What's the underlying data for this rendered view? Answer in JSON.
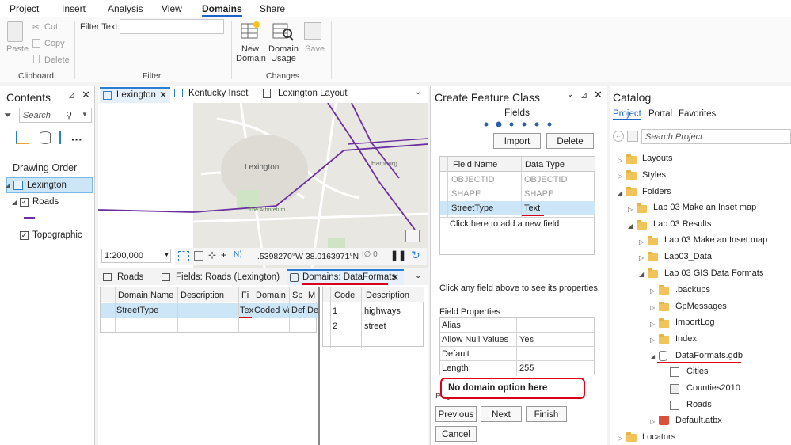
{
  "menu": [
    "Project",
    "Insert",
    "Analysis",
    "View",
    "Domains",
    "Share"
  ],
  "ribbon": {
    "paste": "Paste",
    "cut": "Cut",
    "copy": "Copy",
    "delete": "Delete",
    "clipboard_group": "Clipboard",
    "filter_text_label": "Filter Text:",
    "filter_text_value": "",
    "filter_group": "Filter",
    "new_domain": [
      "New",
      "Domain"
    ],
    "domain_usage": [
      "Domain",
      "Usage"
    ],
    "save": "Save",
    "changes_group": "Changes"
  },
  "contents": {
    "title": "Contents",
    "search_placeholder": "Search",
    "drawing_order": "Drawing Order",
    "layers": [
      "Lexington",
      "Roads",
      "Topographic"
    ]
  },
  "map_tabs": [
    "Lexington",
    "Kentucky Inset",
    "Lexington Layout"
  ],
  "map": {
    "scale": "1:200,000",
    "coords": ".5398270°W 38.0163971°N",
    "labels": [
      "Lexington",
      "Hamburg",
      "The Arboretum"
    ]
  },
  "bottom_tabs": [
    "Roads",
    "Fields:  Roads (Lexington)",
    "Domains: DataFormats"
  ],
  "domains_table": {
    "headers": [
      "Domain Name",
      "Description",
      "Fi",
      "Domain",
      "Sp",
      "M"
    ],
    "row": [
      "StreetType",
      "",
      "Tex",
      "Coded Va",
      "Def",
      "Def"
    ]
  },
  "codes_table": {
    "headers": [
      "Code",
      "Description"
    ],
    "rows": [
      [
        "1",
        "highways"
      ],
      [
        "2",
        "street"
      ]
    ]
  },
  "create_fc": {
    "title": "Create Feature Class",
    "subtitle": "Fields",
    "import": "Import",
    "delete": "Delete",
    "headers": [
      "Field Name",
      "Data Type"
    ],
    "rows": [
      [
        "OBJECTID",
        "OBJECTID"
      ],
      [
        "SHAPE",
        "SHAPE"
      ],
      [
        "StreetType",
        "Text"
      ]
    ],
    "add_field": "Click here to add a new field",
    "hint": "Click any field above to see its properties.",
    "props_title": "Field Properties",
    "props": [
      [
        "Alias",
        ""
      ],
      [
        "Allow Null Values",
        "Yes"
      ],
      [
        "Default",
        ""
      ],
      [
        "Length",
        "255"
      ]
    ],
    "annotation": "No domain option here",
    "page": "Page 2/6",
    "previous": "Previous",
    "next": "Next",
    "finish": "Finish",
    "cancel": "Cancel"
  },
  "catalog": {
    "title": "Catalog",
    "tabs": [
      "Project",
      "Portal",
      "Favorites"
    ],
    "search_placeholder": "Search Project",
    "items": [
      "Layouts",
      "Styles",
      "Folders",
      "Lab 03 Make an Inset map",
      "Lab 03 Results",
      "Lab 03 Make an Inset map",
      "Lab03_Data",
      "Lab 03 GIS Data Formats",
      ".backups",
      "GpMessages",
      "ImportLog",
      "Index",
      "DataFormats.gdb",
      "Cities",
      "Counties2010",
      "Roads",
      "Default.atbx",
      "Locators"
    ]
  }
}
